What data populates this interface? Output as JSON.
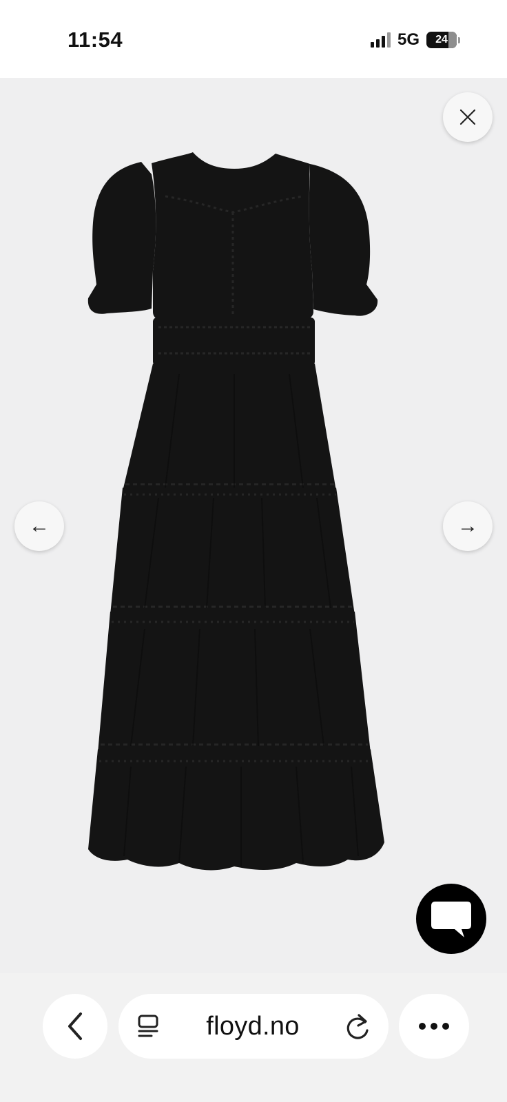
{
  "status_bar": {
    "time": "11:54",
    "network": "5G",
    "battery_level": "24"
  },
  "product_viewer": {
    "close_icon": "close-icon",
    "prev_icon": "arrow-left-icon",
    "next_icon": "arrow-right-icon",
    "prev_glyph": "←",
    "next_glyph": "→",
    "background_color": "#efeff0",
    "product_color": "#141414"
  },
  "chat": {
    "icon": "chat-bubble-icon",
    "color": "#000000"
  },
  "browser": {
    "url": "floyd.no",
    "back_icon": "chevron-left-icon",
    "reader_icon": "reader-icon",
    "reload_icon": "reload-icon",
    "more_icon": "more-dots-icon"
  }
}
